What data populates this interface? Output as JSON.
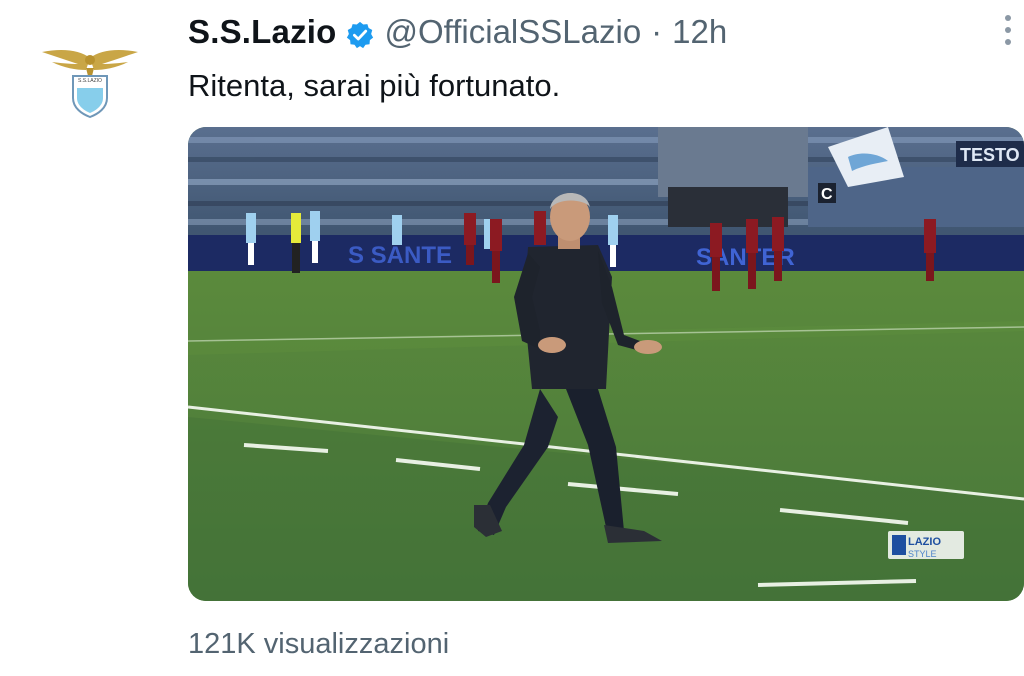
{
  "tweet": {
    "display_name": "S.S.Lazio",
    "handle": "@OfficialSSLazio",
    "separator": "·",
    "time": "12h",
    "text": "Ritenta, sarai più fortunato.",
    "views": "121K visualizzazioni"
  },
  "avatar": {
    "icon": "lazio-eagle-crest-icon",
    "crest_text": "S.S.LAZIO"
  },
  "media": {
    "ad_board_text": "SANTER",
    "ad_board_text_left": "S SANTE",
    "stand_banner": "TESTO",
    "watermark_top": "LAZIO",
    "watermark_bottom": "STYLE"
  },
  "colors": {
    "verified": "#1d9bf0",
    "secondary_text": "#536471",
    "lazio_sky_blue": "#87ceeb",
    "eagle_gold": "#c9a646"
  }
}
